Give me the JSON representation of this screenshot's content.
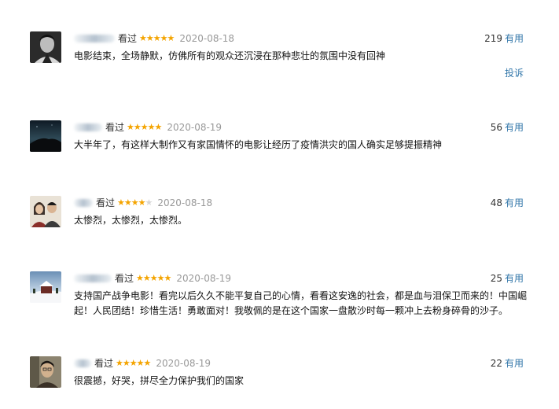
{
  "comments": [
    {
      "watched_label": "看过",
      "rating": 5,
      "stars": "★★★★★",
      "date": "2020-08-18",
      "votes": "219",
      "useful_label": "有用",
      "text": "电影结束，全场静默，仿佛所有的观众还沉浸在那种悲壮的氛围中没有回神",
      "report_label": "投诉"
    },
    {
      "watched_label": "看过",
      "rating": 5,
      "stars": "★★★★★",
      "date": "2020-08-19",
      "votes": "56",
      "useful_label": "有用",
      "text": "大半年了，有这样大制作又有家国情怀的电影让经历了疫情洪灾的国人确实足够提振精神"
    },
    {
      "watched_label": "看过",
      "rating": 4,
      "stars": "★★★★",
      "stars_off": "★",
      "date": "2020-08-18",
      "votes": "48",
      "useful_label": "有用",
      "text": "太惨烈，太惨烈，太惨烈。"
    },
    {
      "watched_label": "看过",
      "rating": 5,
      "stars": "★★★★★",
      "date": "2020-08-19",
      "votes": "25",
      "useful_label": "有用",
      "text": "支持国产战争电影！看完以后久久不能平复自己的心情，看看这安逸的社会，都是血与泪保卫而来的！中国崛起！人民团结！珍惜生活！勇敢面对！我敬佩的是在这个国家一盘散沙时每一颗冲上去粉身碎骨的沙子。"
    },
    {
      "watched_label": "看过",
      "rating": 5,
      "stars": "★★★★★",
      "date": "2020-08-19",
      "votes": "22",
      "useful_label": "有用",
      "text": "很震撼，好哭，拼尽全力保护我们的国家"
    }
  ]
}
